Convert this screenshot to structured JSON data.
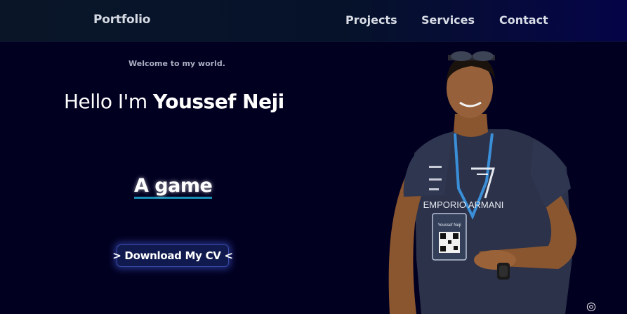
{
  "navbar": {
    "brand": "Portfolio",
    "links": [
      "Projects",
      "Services",
      "Contact"
    ]
  },
  "hero": {
    "welcome": "Welcome to my world.",
    "greeting": "Hello I'm ",
    "name": "Youssef Neji",
    "typed_text": "A game",
    "cv_button": "> Download My CV <"
  },
  "photo": {
    "shirt_brand": "EMPORIO ARMANI",
    "badge_name": "Youssef Neji"
  },
  "colors": {
    "background": "#020021",
    "navbar": "#0a1628",
    "accent": "#1b8fb5",
    "button_glow": "#506eff"
  }
}
